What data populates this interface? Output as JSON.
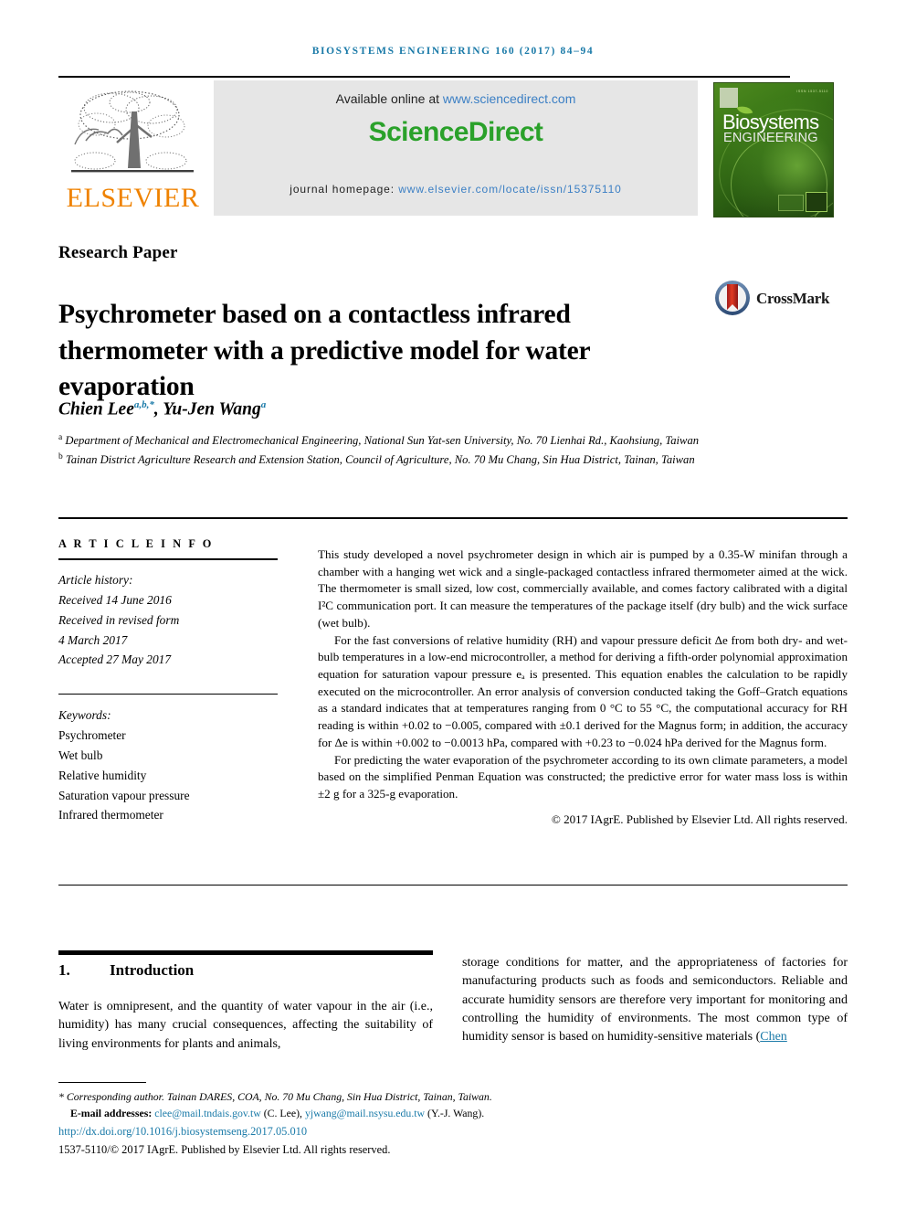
{
  "running_head": "BIOSYSTEMS ENGINEERING 160 (2017) 84–94",
  "masthead": {
    "publisher_name": "ELSEVIER",
    "publisher_logo_icon": "elsevier-tree-icon",
    "available_prefix": "Available online at ",
    "available_url": "www.sciencedirect.com",
    "sciencedirect_logo": "ScienceDirect",
    "homepage_label": "journal homepage: ",
    "homepage_url": "www.elsevier.com/locate/issn/15375110",
    "cover": {
      "title_line1": "Biosystems",
      "title_line2": "ENGINEERING",
      "corner_text": "ISSN 1537-5110"
    }
  },
  "article": {
    "type_label": "Research Paper",
    "title": "Psychrometer based on a contactless infrared thermometer with a predictive model for water evaporation",
    "crossmark_label": "CrossMark",
    "crossmark_icon": "crossmark-icon",
    "authors": [
      {
        "name": "Chien Lee",
        "marks": "a,b,*"
      },
      {
        "name": "Yu-Jen Wang",
        "marks": "a"
      }
    ],
    "affiliations": [
      {
        "mark": "a",
        "text": "Department of Mechanical and Electromechanical Engineering, National Sun Yat-sen University, No. 70 Lienhai Rd., Kaohsiung, Taiwan"
      },
      {
        "mark": "b",
        "text": "Tainan District Agriculture Research and Extension Station, Council of Agriculture, No. 70 Mu Chang, Sin Hua District, Tainan, Taiwan"
      }
    ]
  },
  "article_info": {
    "heading": "A R T I C L E   I N F O",
    "history_label": "Article history:",
    "history": [
      "Received 14 June 2016",
      "Received in revised form",
      "4 March 2017",
      "Accepted 27 May 2017"
    ],
    "keywords_label": "Keywords:",
    "keywords": [
      "Psychrometer",
      "Wet bulb",
      "Relative humidity",
      "Saturation vapour pressure",
      "Infrared thermometer"
    ]
  },
  "abstract": {
    "paragraphs": [
      "This study developed a novel psychrometer design in which air is pumped by a 0.35-W minifan through a chamber with a hanging wet wick and a single-packaged contactless infrared thermometer aimed at the wick. The thermometer is small sized, low cost, commercially available, and comes factory calibrated with a digital I²C communication port. It can measure the temperatures of the package itself (dry bulb) and the wick surface (wet bulb).",
      "For the fast conversions of relative humidity (RH) and vapour pressure deficit Δe from both dry- and wet-bulb temperatures in a low-end microcontroller, a method for deriving a fifth-order polynomial approximation equation for saturation vapour pressure eₐ is presented. This equation enables the calculation to be rapidly executed on the microcontroller. An error analysis of conversion conducted taking the Goff–Gratch equations as a standard indicates that at temperatures ranging from 0 °C to 55 °C, the computational accuracy for RH reading is within +0.02 to −0.005, compared with ±0.1 derived for the Magnus form; in addition, the accuracy for Δe is within +0.002 to −0.0013 hPa, compared with +0.23 to −0.024 hPa derived for the Magnus form.",
      "For predicting the water evaporation of the psychrometer according to its own climate parameters, a model based on the simplified Penman Equation was constructed; the predictive error for water mass loss is within ±2 g for a 325-g evaporation."
    ],
    "copyright": "© 2017 IAgrE. Published by Elsevier Ltd. All rights reserved."
  },
  "body": {
    "section_number": "1.",
    "section_title": "Introduction",
    "left_column": "Water is omnipresent, and the quantity of water vapour in the air (i.e., humidity) has many crucial consequences, affecting the suitability of living environments for plants and animals,",
    "right_column_pre": "storage conditions for matter, and the appropriateness of factories for manufacturing products such as foods and semiconductors. Reliable and accurate humidity sensors are therefore very important for monitoring and controlling the humidity of environments. The most common type of humidity sensor is based on humidity-sensitive materials (",
    "right_column_cite": "Chen"
  },
  "footnotes": {
    "corresponding": "* Corresponding author. Tainan DARES, COA, No. 70 Mu Chang, Sin Hua District, Tainan, Taiwan.",
    "email_label": "E-mail addresses:",
    "email1": "clee@mail.tndais.gov.tw",
    "email1_owner": "(C. Lee),",
    "email2": "yjwang@mail.nsysu.edu.tw",
    "email2_owner": "(Y.-J. Wang).",
    "doi": "http://dx.doi.org/10.1016/j.biosystemseng.2017.05.010",
    "issn_line": "1537-5110/© 2017 IAgrE. Published by Elsevier Ltd. All rights reserved."
  },
  "colors": {
    "link_blue": "#1a7aa8",
    "sciencedirect_green": "#2aa12a",
    "elsevier_orange": "#ef8200",
    "cover_green": "#3d7a18"
  }
}
